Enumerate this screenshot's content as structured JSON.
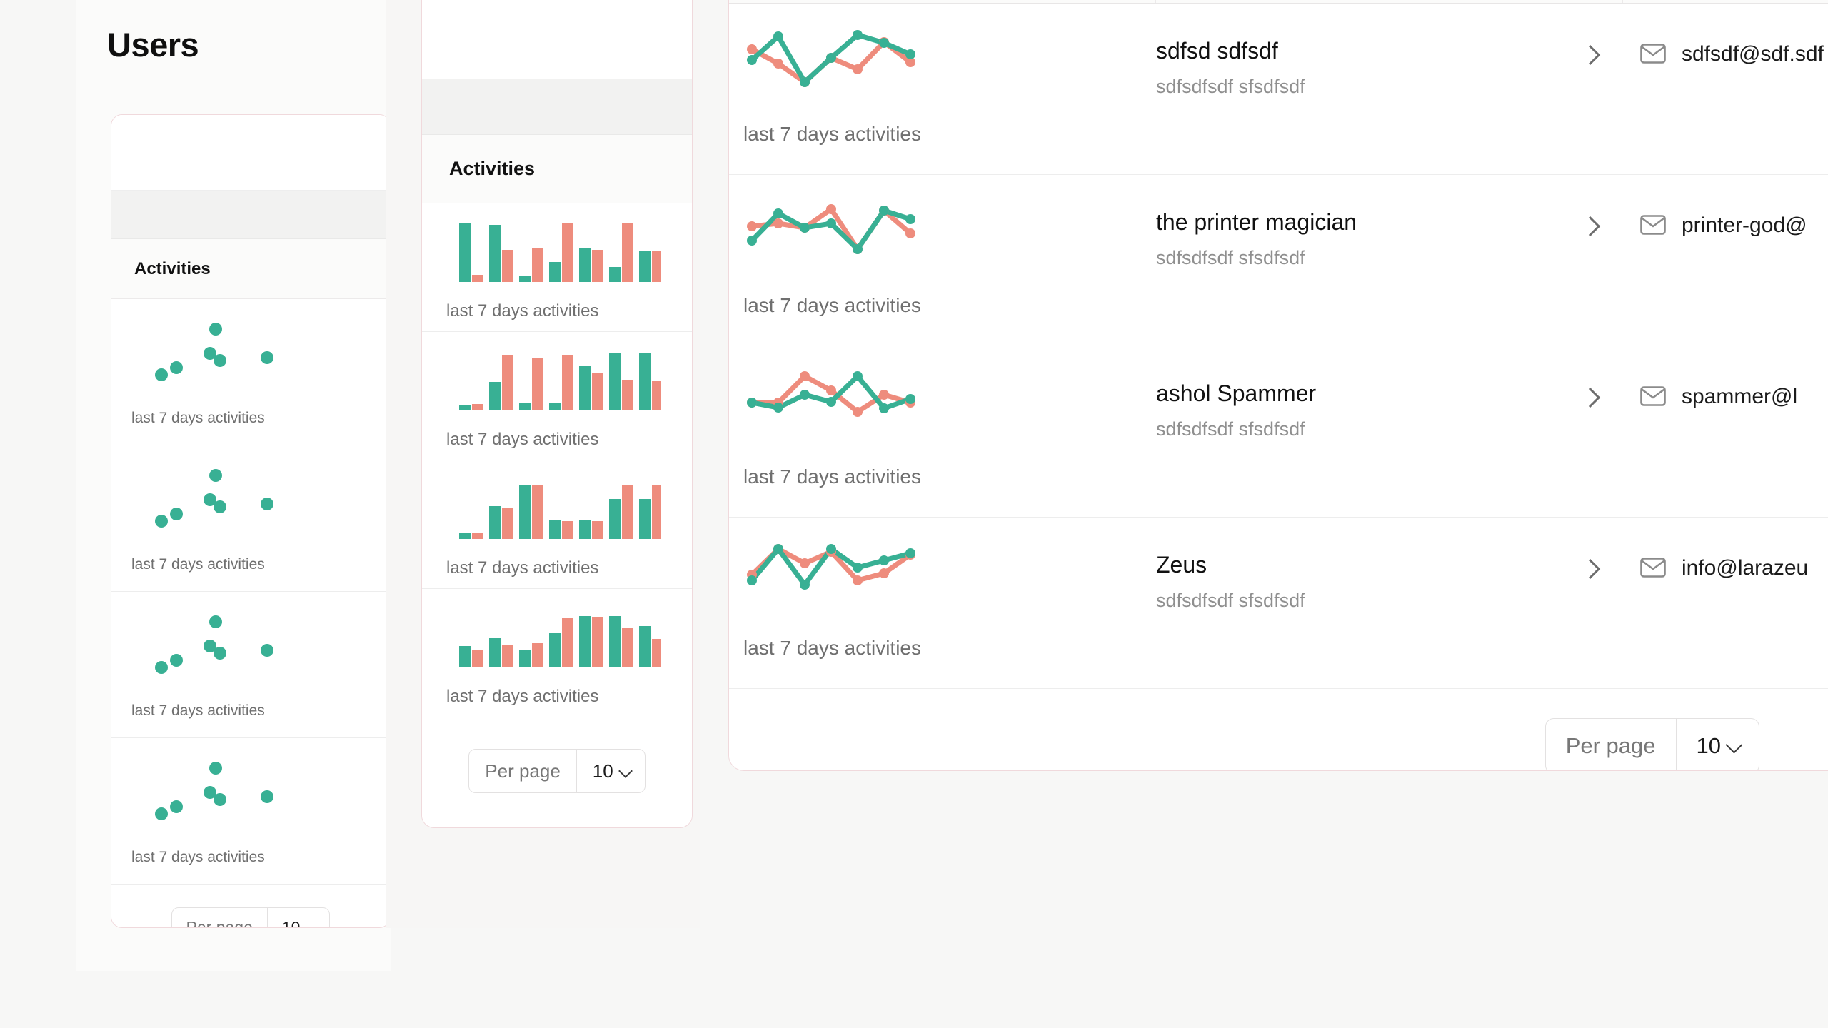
{
  "page": {
    "title": "Users",
    "background_color": "#f7f7f6",
    "panel_border_color": "#f0d9dc"
  },
  "colors": {
    "series_green": "#38b094",
    "series_red": "#ee8c7d",
    "text_primary": "#111111",
    "text_muted": "#8f8f8f",
    "accent_border": "#f0d9dc"
  },
  "table": {
    "activities_header": "Activities",
    "chart_caption": "last 7 days activities",
    "rows": [
      {
        "name": "sdfsd sdfsdf",
        "subtitle": "sdfsdfsdf sfsdfsdf",
        "email": "sdfsdf@sdf.sdf",
        "chevron": "chevron-right-icon",
        "mail": "mail-icon"
      },
      {
        "name": "the printer magician",
        "subtitle": "sdfsdfsdf sfsdfsdf",
        "email": "printer-god@",
        "chevron": "chevron-right-icon",
        "mail": "mail-icon"
      },
      {
        "name": "ashol Spammer",
        "subtitle": "sdfsdfsdf sfsdfsdf",
        "email": "spammer@l",
        "chevron": "chevron-right-icon",
        "mail": "mail-icon"
      },
      {
        "name": "Zeus",
        "subtitle": "sdfsdfsdf sfsdfsdf",
        "email": "info@larazeu",
        "chevron": "chevron-right-icon",
        "mail": "mail-icon"
      }
    ]
  },
  "pagination": {
    "label": "Per page",
    "value": "10",
    "chevron": "chevron-down-icon"
  },
  "chart_data": [
    {
      "id": "front-line-row-1",
      "type": "line",
      "title": "last 7 days activities",
      "x": [
        1,
        2,
        3,
        4,
        5,
        6,
        7
      ],
      "xlabel": "",
      "ylabel": "",
      "ylim": [
        0,
        10
      ],
      "grid": false,
      "legend": "none",
      "series": [
        {
          "name": "green",
          "color": "#38b094",
          "values": [
            3.4,
            7.0,
            1.0,
            4.6,
            7.4,
            6.5,
            5.6
          ]
        },
        {
          "name": "red",
          "color": "#ee8c7d",
          "values": [
            5.1,
            3.2,
            1.0,
            4.6,
            3.0,
            6.6,
            3.4
          ]
        }
      ]
    },
    {
      "id": "front-line-row-2",
      "type": "line",
      "title": "last 7 days activities",
      "x": [
        1,
        2,
        3,
        4,
        5,
        6,
        7
      ],
      "ylim": [
        0,
        10
      ],
      "grid": false,
      "legend": "none",
      "series": [
        {
          "name": "green",
          "color": "#38b094",
          "values": [
            3.0,
            6.8,
            5.0,
            5.6,
            2.0,
            7.5,
            6.6
          ]
        },
        {
          "name": "red",
          "color": "#ee8c7d",
          "values": [
            5.3,
            5.4,
            5.0,
            7.4,
            2.0,
            7.0,
            4.3
          ]
        }
      ]
    },
    {
      "id": "front-line-row-3",
      "type": "line",
      "title": "last 7 days activities",
      "x": [
        1,
        2,
        3,
        4,
        5,
        6,
        7
      ],
      "ylim": [
        0,
        10
      ],
      "grid": false,
      "legend": "none",
      "series": [
        {
          "name": "green",
          "color": "#38b094",
          "values": [
            4.5,
            3.5,
            5.6,
            4.6,
            8.0,
            3.3,
            4.9
          ]
        },
        {
          "name": "red",
          "color": "#ee8c7d",
          "values": [
            4.5,
            4.4,
            8.3,
            6.5,
            2.8,
            5.7,
            4.5
          ]
        }
      ]
    },
    {
      "id": "front-line-row-4",
      "type": "line",
      "title": "last 7 days activities",
      "x": [
        1,
        2,
        3,
        4,
        5,
        6,
        7
      ],
      "ylim": [
        0,
        10
      ],
      "grid": false,
      "legend": "none",
      "series": [
        {
          "name": "green",
          "color": "#38b094",
          "values": [
            3.3,
            8.3,
            2.8,
            8.4,
            5.3,
            6.2,
            7.0
          ]
        },
        {
          "name": "red",
          "color": "#ee8c7d",
          "values": [
            4.0,
            8.0,
            6.3,
            7.9,
            3.4,
            4.4,
            7.0
          ]
        }
      ]
    },
    {
      "id": "mid-bars-1",
      "type": "bar",
      "title": "last 7 days activities",
      "categories": [
        "1",
        "2",
        "3",
        "4",
        "5",
        "6",
        "7"
      ],
      "ylim": [
        0,
        10
      ],
      "grid": false,
      "legend": "none",
      "series": [
        {
          "name": "green",
          "color": "#38b094",
          "values": [
            9.5,
            9.3,
            1.0,
            3.3,
            5.5,
            2.5,
            5.2
          ]
        },
        {
          "name": "red",
          "color": "#ee8c7d",
          "values": [
            1.2,
            5.2,
            5.5,
            9.5,
            5.3,
            9.2,
            5.1
          ]
        }
      ]
    },
    {
      "id": "mid-bars-2",
      "type": "bar",
      "title": "last 7 days activities",
      "categories": [
        "1",
        "2",
        "3",
        "4",
        "5",
        "6",
        "7"
      ],
      "ylim": [
        0,
        10
      ],
      "grid": false,
      "legend": "none",
      "series": [
        {
          "name": "green",
          "color": "#38b094",
          "values": [
            1.0,
            4.8,
            1.2,
            1.2,
            7.5,
            9.0,
            9.2
          ]
        },
        {
          "name": "red",
          "color": "#ee8c7d",
          "values": [
            1.1,
            9.3,
            8.5,
            9.3,
            6.5,
            4.6,
            4.5
          ]
        }
      ]
    },
    {
      "id": "mid-bars-3",
      "type": "bar",
      "title": "last 7 days activities",
      "categories": [
        "1",
        "2",
        "3",
        "4",
        "5",
        "6",
        "7"
      ],
      "ylim": [
        0,
        10
      ],
      "grid": false,
      "legend": "none",
      "series": [
        {
          "name": "green",
          "color": "#38b094",
          "values": [
            1.0,
            5.5,
            9.5,
            3.0,
            3.0,
            7.0,
            7.0
          ]
        },
        {
          "name": "red",
          "color": "#ee8c7d",
          "values": [
            1.2,
            5.0,
            9.2,
            2.8,
            2.8,
            9.5,
            9.5
          ]
        }
      ]
    },
    {
      "id": "mid-bars-4",
      "type": "bar",
      "title": "last 7 days activities",
      "categories": [
        "1",
        "2",
        "3",
        "4",
        "5",
        "6",
        "7"
      ],
      "ylim": [
        0,
        10
      ],
      "grid": false,
      "legend": "none",
      "series": [
        {
          "name": "green",
          "color": "#38b094",
          "values": [
            3.2,
            4.6,
            2.6,
            5.4,
            8.2,
            8.2,
            6.0
          ]
        },
        {
          "name": "red",
          "color": "#ee8c7d",
          "values": [
            2.6,
            3.2,
            3.6,
            8.0,
            8.2,
            6.6,
            4.4
          ]
        }
      ]
    },
    {
      "id": "left-scatter-1",
      "type": "scatter",
      "title": "last 7 days activities",
      "ylim": [
        0,
        10
      ],
      "xlim": [
        0,
        10
      ],
      "grid": false,
      "legend": "none",
      "series": [
        {
          "name": "green",
          "color": "#38b094",
          "points": [
            [
              1.1,
              3.0
            ],
            [
              1.6,
              3.6
            ],
            [
              3.5,
              5.0
            ],
            [
              4.0,
              4.3
            ],
            [
              3.9,
              7.4
            ],
            [
              6.6,
              4.6
            ]
          ]
        }
      ]
    },
    {
      "id": "left-scatter-2",
      "type": "scatter",
      "title": "last 7 days activities",
      "ylim": [
        0,
        10
      ],
      "xlim": [
        0,
        10
      ],
      "grid": false,
      "legend": "none",
      "series": [
        {
          "name": "green",
          "color": "#38b094",
          "points": [
            [
              1.1,
              3.0
            ],
            [
              1.6,
              3.6
            ],
            [
              3.5,
              5.0
            ],
            [
              4.0,
              4.3
            ],
            [
              3.9,
              7.4
            ],
            [
              6.6,
              4.6
            ]
          ]
        }
      ]
    },
    {
      "id": "left-scatter-3",
      "type": "scatter",
      "title": "last 7 days activities",
      "ylim": [
        0,
        10
      ],
      "xlim": [
        0,
        10
      ],
      "grid": false,
      "legend": "none",
      "series": [
        {
          "name": "green",
          "color": "#38b094",
          "points": [
            [
              1.1,
              3.0
            ],
            [
              1.6,
              3.6
            ],
            [
              3.5,
              5.0
            ],
            [
              4.0,
              4.3
            ],
            [
              3.9,
              7.4
            ],
            [
              6.6,
              4.6
            ]
          ]
        }
      ]
    },
    {
      "id": "left-scatter-4",
      "type": "scatter",
      "title": "last 7 days activities",
      "ylim": [
        0,
        10
      ],
      "xlim": [
        0,
        10
      ],
      "grid": false,
      "legend": "none",
      "series": [
        {
          "name": "green",
          "color": "#38b094",
          "points": [
            [
              1.1,
              3.0
            ],
            [
              1.6,
              3.6
            ],
            [
              3.5,
              5.0
            ],
            [
              4.0,
              4.3
            ],
            [
              3.9,
              7.4
            ],
            [
              6.6,
              4.6
            ]
          ]
        }
      ]
    }
  ]
}
